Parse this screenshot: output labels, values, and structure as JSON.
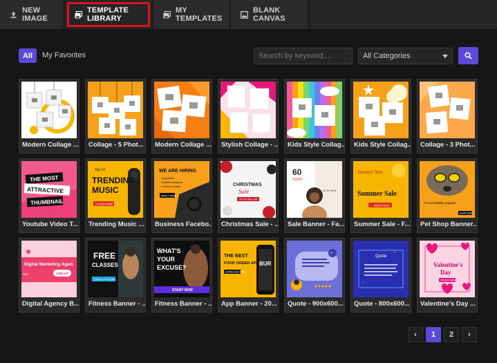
{
  "tabs": [
    {
      "label": "NEW IMAGE",
      "icon": "upload-icon"
    },
    {
      "label": "TEMPLATE LIBRARY",
      "icon": "image-gallery-icon",
      "active": true
    },
    {
      "label": "MY TEMPLATES",
      "icon": "image-gallery-icon"
    },
    {
      "label": "BLANK CANVAS",
      "icon": "image-icon"
    }
  ],
  "filters": {
    "all_label": "All",
    "favorites_label": "My Favorites",
    "search_placeholder": "Search by keyword...",
    "category_value": "All Categories",
    "accent_color": "#5b4ad8"
  },
  "templates": [
    {
      "title": "Modern Collage ..."
    },
    {
      "title": "Collage - 5 Phot..."
    },
    {
      "title": "Modern Collage ..."
    },
    {
      "title": "Stylish Collage - ..."
    },
    {
      "title": "Kids Style Collag..."
    },
    {
      "title": "Kids Style Collag..."
    },
    {
      "title": "Collage - 3 Phot..."
    },
    {
      "title": "Youtube Video T...",
      "thumb_text": [
        "THE MOST",
        "ATTRACTIVE",
        "THUMBNAIL"
      ]
    },
    {
      "title": "Trending Music ...",
      "thumb_text": [
        "Top 10",
        "TRENDING",
        "MUSIC",
        "LISTEN NOW"
      ]
    },
    {
      "title": "Business Facebo...",
      "thumb_text": [
        "WE ARE HIRING",
        "Copywriter",
        "Graphic Designer",
        "Content Creator",
        "APPLY NOW"
      ]
    },
    {
      "title": "Christmas Sale - ...",
      "thumb_text": [
        "CHRISTMAS",
        "Sale",
        "UP TO 30% OFF"
      ]
    },
    {
      "title": "Sale Banner - Fa...",
      "thumb_text": [
        "60",
        "%OFF",
        "SHOP NOW"
      ]
    },
    {
      "title": "Summer Sale - F...",
      "thumb_text": [
        "Summer Sale",
        "Summer Sale",
        "SHOP NOW"
      ]
    },
    {
      "title": "Pet Shop Banner...",
      "thumb_text": [
        "Fit and healthy puppies.",
        "SHOP NOW"
      ]
    },
    {
      "title": "Digital Agency B...",
      "thumb_text": [
        "Digital Marketing Agen",
        "JOIN US",
        "ncy"
      ]
    },
    {
      "title": "Fitness Banner - ...",
      "thumb_text": [
        "FREE",
        "CLASSES",
        "SIGN UP TODAY"
      ]
    },
    {
      "title": "Fitness Banner - ...",
      "thumb_text": [
        "WHAT'S",
        "YOUR",
        "EXCUSE?",
        "START NOW"
      ]
    },
    {
      "title": "App Banner - 20...",
      "thumb_text": [
        "THE BEST",
        "FOOD ORDER APP",
        "DOWNLOAD NOW",
        "BUR"
      ]
    },
    {
      "title": "Quote - 900x600...",
      "thumb_text": [
        "”"
      ]
    },
    {
      "title": "Quote - 800x600...",
      "thumb_text": [
        "Quote",
        "“",
        "”"
      ]
    },
    {
      "title": "Valentine's Day ...",
      "thumb_text": [
        "Valentine's",
        "Day",
        "ORDER NOW"
      ]
    }
  ],
  "pagination": {
    "prev": "‹",
    "pages": [
      "1",
      "2"
    ],
    "current": "1",
    "next": "›"
  }
}
